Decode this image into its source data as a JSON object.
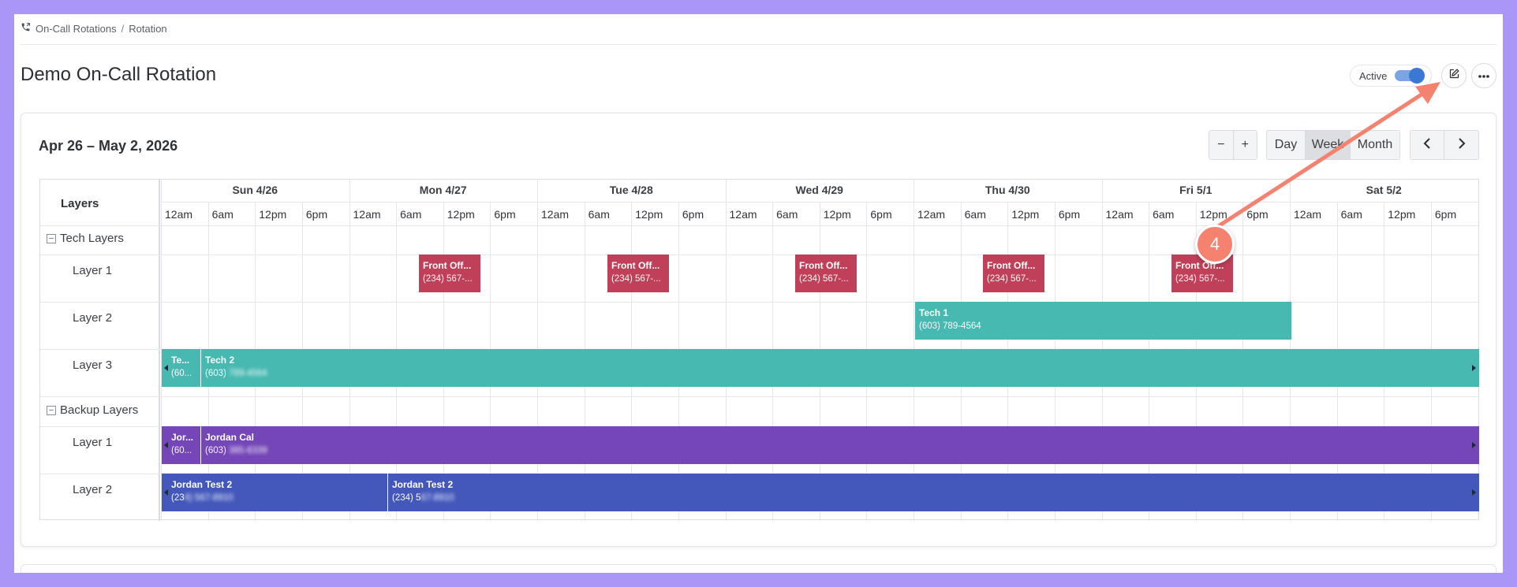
{
  "breadcrumb": {
    "items": [
      "On-Call Rotations",
      "Rotation"
    ],
    "separator": "/"
  },
  "page": {
    "title": "Demo On-Call Rotation",
    "active_label": "Active",
    "active": true
  },
  "calendar": {
    "range_title": "Apr 26 – May 2, 2026",
    "zoom_out": "−",
    "zoom_in": "+",
    "views": [
      "Day",
      "Week",
      "Month"
    ],
    "selected_view": "Week",
    "prev": "‹",
    "next": "›",
    "layers_header": "Layers",
    "days": [
      "Sun 4/26",
      "Mon 4/27",
      "Tue 4/28",
      "Wed 4/29",
      "Thu 4/30",
      "Fri 5/1",
      "Sat 5/2"
    ],
    "times": [
      "12am",
      "6am",
      "12pm",
      "6pm"
    ],
    "groups": [
      {
        "name": "Tech Layers",
        "layers": [
          "Layer 1",
          "Layer 2",
          "Layer 3"
        ]
      },
      {
        "name": "Backup Layers",
        "layers": [
          "Layer 1",
          "Layer 2"
        ]
      }
    ],
    "events": {
      "front_office": {
        "title": "Front Off...",
        "phone": "(234) 567-..."
      },
      "tech1": {
        "title": "Tech 1",
        "phone": "(603) 789-4564"
      },
      "tech_small": {
        "title": "Te...",
        "phone": "(60..."
      },
      "tech2": {
        "title": "Tech 2",
        "phone": "(603)",
        "phone_hidden": "789-4564"
      },
      "jordan_small": {
        "title": "Jor...",
        "phone": "(60..."
      },
      "jordan_cal": {
        "title": "Jordan Cal",
        "phone": "(603)",
        "phone_hidden": "385-6339"
      },
      "jordan_test_a": {
        "title": "Jordan Test 2",
        "phone": "(23",
        "phone_hidden": "4) 567-8910"
      },
      "jordan_test_b": {
        "title": "Jordan Test 2",
        "phone": "(234) 5",
        "phone_hidden": "67-8910"
      }
    }
  },
  "callout": {
    "number": "4"
  },
  "colors": {
    "red": "#c04059",
    "teal": "#47b9b1",
    "purple": "#7446b8",
    "blue": "#4458bc",
    "accent": "#f5826f"
  }
}
